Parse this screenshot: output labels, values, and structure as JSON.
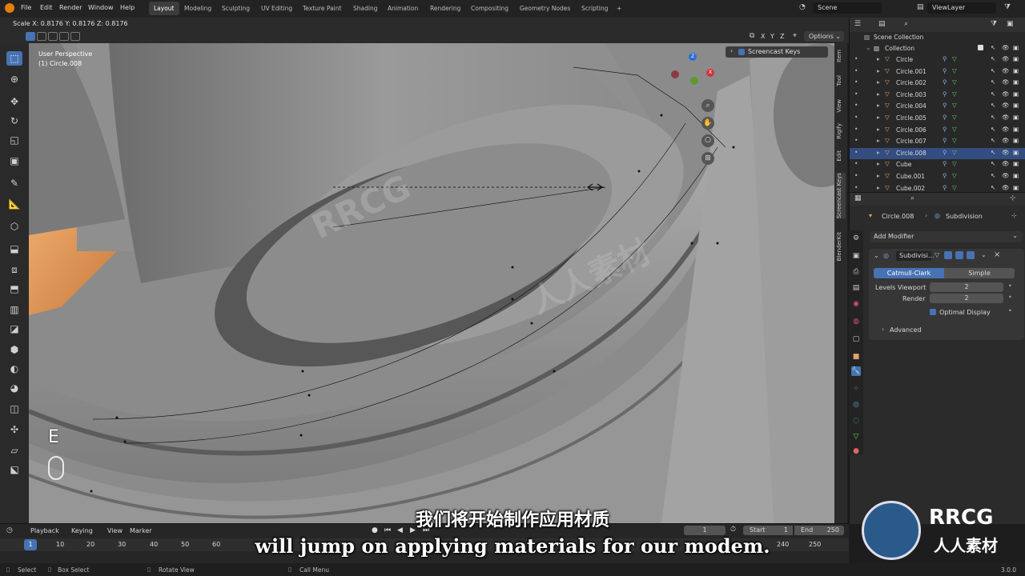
{
  "menubar": {
    "items": [
      "File",
      "Edit",
      "Render",
      "Window",
      "Help"
    ],
    "workspaces": [
      "Layout",
      "Modeling",
      "Sculpting",
      "UV Editing",
      "Texture Paint",
      "Shading",
      "Animation",
      "Rendering",
      "Compositing",
      "Geometry Nodes",
      "Scripting"
    ],
    "active_workspace": "Layout",
    "add_tab": "+",
    "scene": "Scene",
    "view_layer": "ViewLayer"
  },
  "header": {
    "scale_readout": "Scale X: 0.8176   Y: 0.8176   Z: 0.8176",
    "axes": [
      "X",
      "Y",
      "Z"
    ],
    "options_label": "Options"
  },
  "viewport": {
    "perspective": "User Perspective",
    "object": "(1) Circle.008",
    "key_hint": "E",
    "screencast_label": "Screencast Keys",
    "gizmo": {
      "x": "X",
      "y": "Y",
      "z": "Z"
    }
  },
  "n_tabs": [
    "Item",
    "Tool",
    "View",
    "Rigify",
    "Edit",
    "Screencast Keys",
    "BlenderKit"
  ],
  "outliner": {
    "scene_collection": "Scene Collection",
    "collection": "Collection",
    "objects": [
      "Circle",
      "Circle.001",
      "Circle.002",
      "Circle.003",
      "Circle.004",
      "Circle.005",
      "Circle.006",
      "Circle.007",
      "Circle.008",
      "Cube",
      "Cube.001",
      "Cube.002"
    ],
    "selected": "Circle.008"
  },
  "properties": {
    "object_name": "Circle.008",
    "modifier_crumb": "Subdivision",
    "add_modifier": "Add Modifier",
    "modifier_name": "Subdivisi...",
    "mode_catmull": "Catmull-Clark",
    "mode_simple": "Simple",
    "levels_viewport_label": "Levels Viewport",
    "levels_viewport_value": "2",
    "render_label": "Render",
    "render_value": "2",
    "optimal_display": "Optimal Display",
    "advanced": "Advanced"
  },
  "timeline": {
    "menus": [
      "Playback",
      "Keying",
      "View",
      "Marker"
    ],
    "current_frame": "1",
    "start_label": "Start",
    "start_value": "1",
    "end_label": "End",
    "end_value": "250",
    "ticks": [
      "1",
      "10",
      "20",
      "30",
      "40",
      "50",
      "60",
      "240",
      "250"
    ],
    "current_marker": "1"
  },
  "statusbar": {
    "select": "Select",
    "box_select": "Box Select",
    "rotate_view": "Rotate View",
    "call_menu": "Call Menu",
    "version": "3.0.0"
  },
  "subtitles": {
    "chinese": "我们将开始制作应用材质",
    "english": "will jump on applying materials for our modem."
  },
  "watermark": {
    "brand": "RRCG",
    "brand_cn": "人人素材"
  },
  "colors": {
    "accent": "#4772b3",
    "viewport": "#8e8e8e",
    "selected_row": "#334d80",
    "orange_object": "#e8a060"
  }
}
